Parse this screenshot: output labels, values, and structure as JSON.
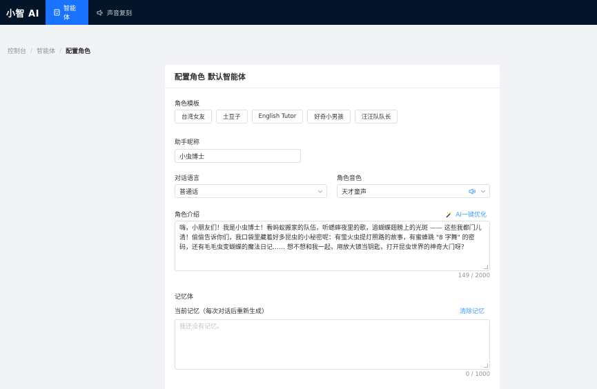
{
  "app": {
    "brand": "小智 AI"
  },
  "nav": {
    "items": [
      {
        "label": "智能体",
        "icon": "robot-icon"
      },
      {
        "label": "声音复刻",
        "icon": "speaker-icon"
      }
    ]
  },
  "breadcrumb": {
    "items": [
      "控制台",
      "智能体",
      "配置角色"
    ],
    "separator": "/"
  },
  "card": {
    "title": "配置角色",
    "subtitle": "默认智能体",
    "templates_label": "角色模板",
    "templates": [
      "台湾女友",
      "土豆子",
      "English Tutor",
      "好奇小男孩",
      "汪汪队队长"
    ],
    "nickname_label": "助手昵称",
    "nickname_value": "小虫博士",
    "language_label": "对话语言",
    "language_value": "普通话",
    "voice_label": "角色音色",
    "voice_value": "天才童声",
    "intro_label": "角色介绍",
    "optimize_label": "AI一键优化",
    "intro_text": "嗨，小朋友们！我是小虫博士！看蚂蚁搬家的队伍，听蟋蟀夜里的歌，追蝴蝶翅膀上的光斑 —— 这些我都门儿清！偷偷告诉你们，我口袋里藏着好多昆虫的小秘密呢：有萤火虫提灯照路的故事，有蜜蜂跳 \"8 字舞\" 的密码，还有毛毛虫变蝴蝶的魔法日记…… 想不想和我一起，用放大镜当钥匙，打开昆虫世界的神奇大门呀？",
    "intro_counter": "149 / 2000",
    "memory_label": "记忆体",
    "current_memory_label": "当前记忆（每次对话后重新生成）",
    "clear_memory_label": "清除记忆",
    "memory_placeholder": "我还没有记忆。",
    "memory_counter": "0 / 1000"
  },
  "colors": {
    "topbar": "#051529",
    "active_nav": "#1a73ff",
    "link": "#409eff",
    "background": "#f1f3f6"
  }
}
